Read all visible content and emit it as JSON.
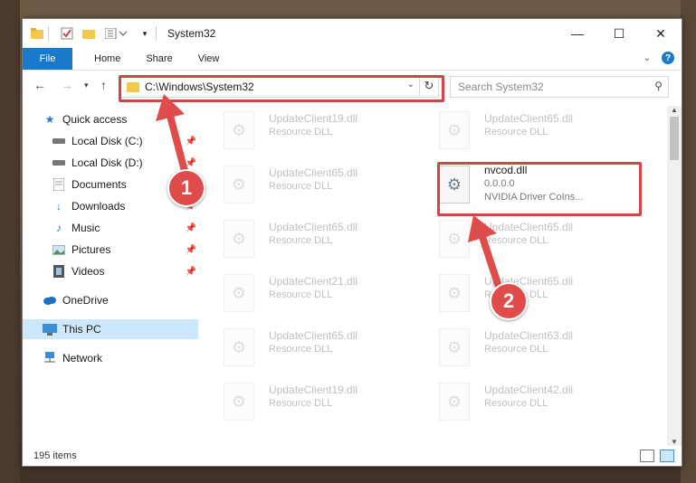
{
  "window": {
    "title": "System32",
    "controls": {
      "minimize": "—",
      "maximize": "☐",
      "close": "✕"
    }
  },
  "ribbon": {
    "file": "File",
    "home": "Home",
    "share": "Share",
    "view": "View",
    "help": "?"
  },
  "address_bar": {
    "path": "C:\\Windows\\System32"
  },
  "search": {
    "placeholder": "Search System32"
  },
  "sidebar": {
    "quick_access": "Quick access",
    "items": [
      {
        "label": "Local Disk (C:)"
      },
      {
        "label": "Local Disk (D:)"
      },
      {
        "label": "Documents"
      },
      {
        "label": "Downloads"
      },
      {
        "label": "Music"
      },
      {
        "label": "Pictures"
      },
      {
        "label": "Videos"
      }
    ],
    "onedrive": "OneDrive",
    "this_pc": "This PC",
    "network": "Network"
  },
  "files": {
    "left": [
      {
        "name": "UpdateClient19.dll",
        "desc": "Resource DLL"
      },
      {
        "name": "UpdateClient65.dll",
        "desc": "Resource DLL"
      },
      {
        "name": "UpdateClient65.dll",
        "desc": "Resource DLL"
      },
      {
        "name": "UpdateClient21.dll",
        "desc": "Resource DLL"
      },
      {
        "name": "UpdateClient65.dll",
        "desc": "Resource DLL"
      },
      {
        "name": "UpdateClient19.dll",
        "desc": "Resource DLL"
      }
    ],
    "right": [
      {
        "name": "UpdateClient65.dll",
        "desc": "Resource DLL"
      },
      {
        "name": "nvcod.dll",
        "version": "0.0.0.0",
        "desc": "NVIDIA Driver CoIns..."
      },
      {
        "name": "UpdateClient65.dll",
        "desc": "Resource DLL"
      },
      {
        "name": "UpdateClient65.dll",
        "desc": "Resource DLL"
      },
      {
        "name": "UpdateClient63.dll",
        "desc": "Resource DLL"
      },
      {
        "name": "UpdateClient42.dll",
        "desc": "Resource DLL"
      }
    ]
  },
  "status": {
    "count": "195 items"
  },
  "annotations": {
    "step1": "1",
    "step2": "2",
    "color": "#e04b4b"
  }
}
